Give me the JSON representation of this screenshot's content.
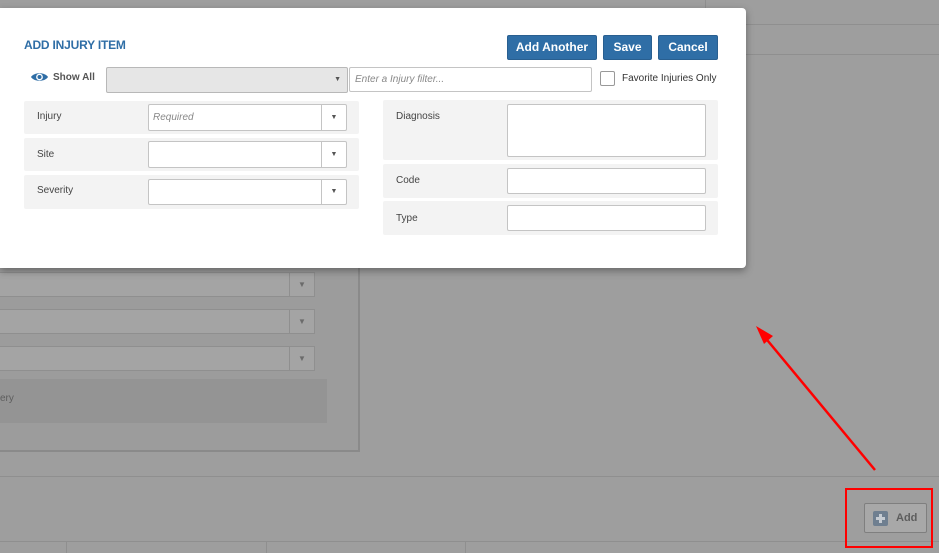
{
  "modal": {
    "title": "ADD INJURY ITEM",
    "buttons": {
      "add_another": "Add Another",
      "save": "Save",
      "cancel": "Cancel"
    },
    "show_all_label": "Show All",
    "filter_select_value": "",
    "filter_input_placeholder": "Enter a Injury filter...",
    "favorite_label": "Favorite Injuries Only",
    "favorite_checked": false,
    "left_fields": [
      {
        "label": "Injury",
        "placeholder": "Required",
        "value": ""
      },
      {
        "label": "Site",
        "placeholder": "",
        "value": ""
      },
      {
        "label": "Severity",
        "placeholder": "",
        "value": ""
      }
    ],
    "right_fields": [
      {
        "label": "Diagnosis",
        "value": ""
      },
      {
        "label": "Code",
        "value": ""
      },
      {
        "label": "Type",
        "value": ""
      }
    ]
  },
  "background": {
    "partial_text": "ery",
    "add_button_label": "Add"
  },
  "colors": {
    "accent": "#2f6ea6",
    "overlay": "#9e9e9e",
    "annotation": "#ff0000"
  },
  "icons": {
    "show_all": "eye-icon",
    "dropdown": "chevron-down-icon",
    "add": "plus-square-icon"
  }
}
